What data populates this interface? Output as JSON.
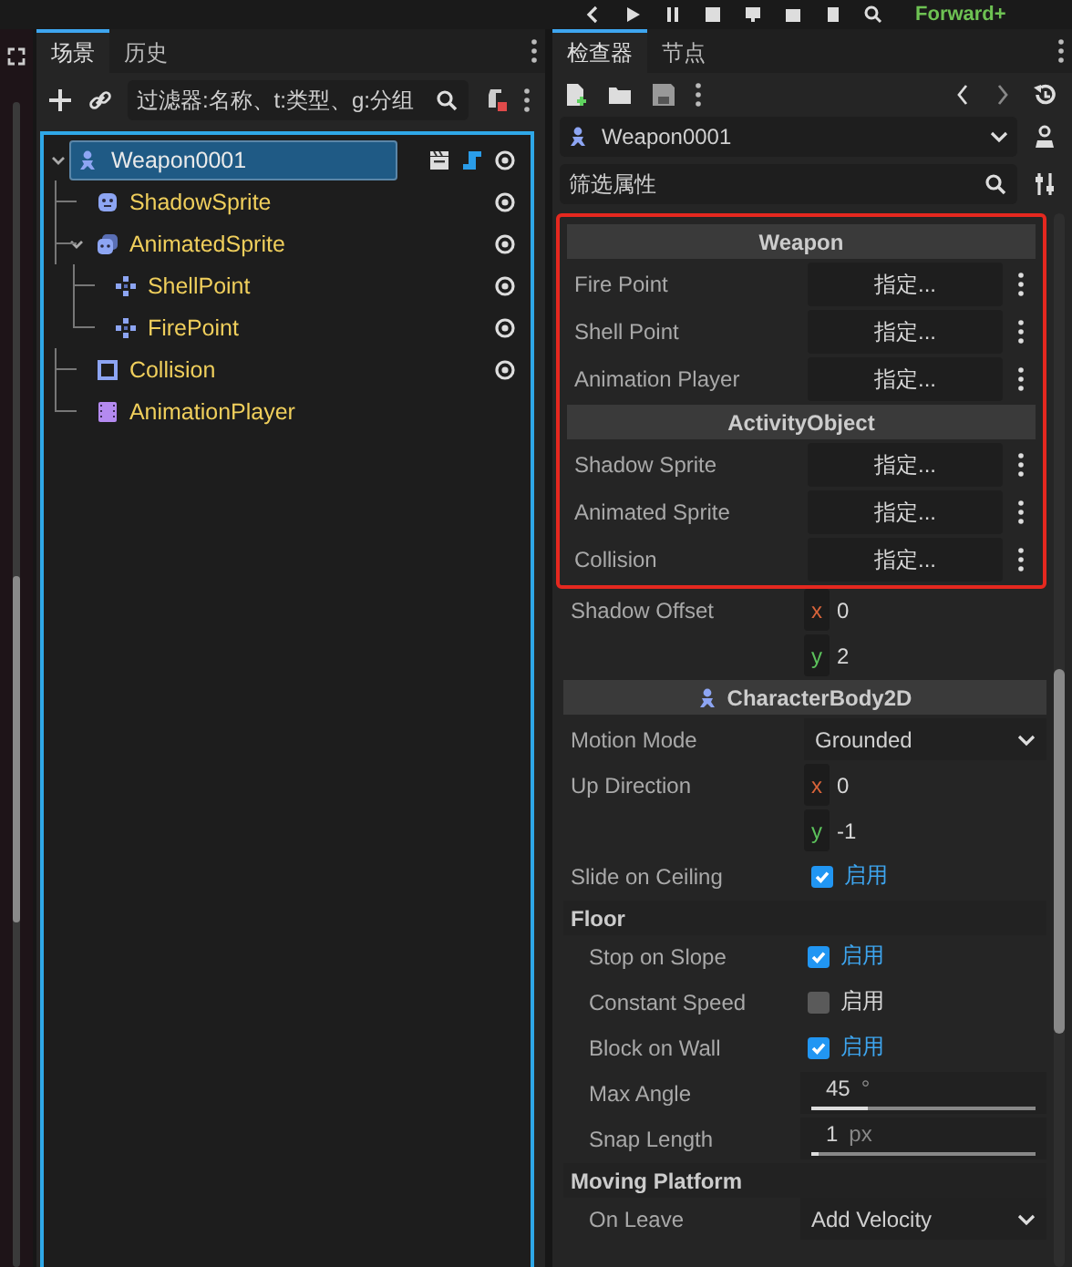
{
  "top_bar": {
    "renderer": "Forward+"
  },
  "scene_dock": {
    "tabs": [
      {
        "label": "场景",
        "selected": true
      },
      {
        "label": "历史",
        "selected": false
      }
    ],
    "filter": {
      "placeholder": "过滤器:名称、t:类型、g:分组"
    },
    "tree": [
      {
        "name": "Weapon0001",
        "kind": "character",
        "selected": true,
        "expanded": true,
        "instanced": true,
        "has_script": true,
        "visibility_toggle": true,
        "children": [
          {
            "name": "ShadowSprite",
            "kind": "sprite",
            "selected": false,
            "instanced": false,
            "has_script": false,
            "visibility_toggle": true
          },
          {
            "name": "AnimatedSprite",
            "kind": "animated-sprite",
            "selected": false,
            "expanded": true,
            "instanced": false,
            "has_script": false,
            "visibility_toggle": true,
            "children": [
              {
                "name": "ShellPoint",
                "kind": "marker",
                "selected": false,
                "instanced": false,
                "has_script": false,
                "visibility_toggle": true
              },
              {
                "name": "FirePoint",
                "kind": "marker",
                "selected": false,
                "instanced": false,
                "has_script": false,
                "visibility_toggle": true
              }
            ]
          },
          {
            "name": "Collision",
            "kind": "collision",
            "selected": false,
            "instanced": false,
            "has_script": false,
            "visibility_toggle": true
          },
          {
            "name": "AnimationPlayer",
            "kind": "animation-player",
            "selected": false,
            "instanced": false,
            "has_script": false,
            "visibility_toggle": false
          }
        ]
      }
    ]
  },
  "inspector": {
    "tabs": [
      {
        "label": "检查器",
        "selected": true
      },
      {
        "label": "节点",
        "selected": false
      }
    ],
    "object": {
      "name": "Weapon0001"
    },
    "filter": {
      "placeholder": "筛选属性"
    },
    "blocks": [
      {
        "highlighted": true,
        "rows": [
          {
            "kind": "header",
            "label": "Weapon",
            "icon": false
          },
          {
            "kind": "node_ref",
            "label": "Fire Point",
            "value": "指定..."
          },
          {
            "kind": "node_ref",
            "label": "Shell Point",
            "value": "指定..."
          },
          {
            "kind": "node_ref",
            "label": "Animation Player",
            "value": "指定..."
          },
          {
            "kind": "header",
            "label": "ActivityObject",
            "icon": false
          },
          {
            "kind": "node_ref",
            "label": "Shadow Sprite",
            "value": "指定..."
          },
          {
            "kind": "node_ref",
            "label": "Animated Sprite",
            "value": "指定..."
          },
          {
            "kind": "node_ref",
            "label": "Collision",
            "value": "指定..."
          }
        ]
      },
      {
        "highlighted": false,
        "rows": [
          {
            "kind": "vector",
            "label": "Shadow Offset",
            "components": [
              {
                "axis": "x",
                "value": "0"
              },
              {
                "axis": "y",
                "value": "2"
              }
            ]
          },
          {
            "kind": "header",
            "label": "CharacterBody2D",
            "icon": true
          },
          {
            "kind": "enum",
            "label": "Motion Mode",
            "value": "Grounded"
          },
          {
            "kind": "vector",
            "label": "Up Direction",
            "components": [
              {
                "axis": "x",
                "value": "0"
              },
              {
                "axis": "y",
                "value": "-1"
              }
            ]
          },
          {
            "kind": "checkbox",
            "label": "Slide on Ceiling",
            "checked": true,
            "value": "启用"
          },
          {
            "kind": "subheader",
            "label": "Floor",
            "children": [
              {
                "kind": "checkbox",
                "label": "Stop on Slope",
                "checked": true,
                "value": "启用"
              },
              {
                "kind": "checkbox",
                "label": "Constant Speed",
                "checked": false,
                "value": "启用"
              },
              {
                "kind": "checkbox",
                "label": "Block on Wall",
                "checked": true,
                "value": "启用"
              },
              {
                "kind": "slider",
                "label": "Max Angle",
                "value": "45",
                "unit": "°",
                "level": 0.25
              },
              {
                "kind": "slider",
                "label": "Snap Length",
                "value": "1",
                "unit": "px",
                "level": 0.03
              }
            ]
          },
          {
            "kind": "subheader",
            "label": "Moving Platform",
            "children": [
              {
                "kind": "enum",
                "label": "On Leave",
                "value": "Add Velocity"
              }
            ]
          }
        ]
      }
    ]
  }
}
